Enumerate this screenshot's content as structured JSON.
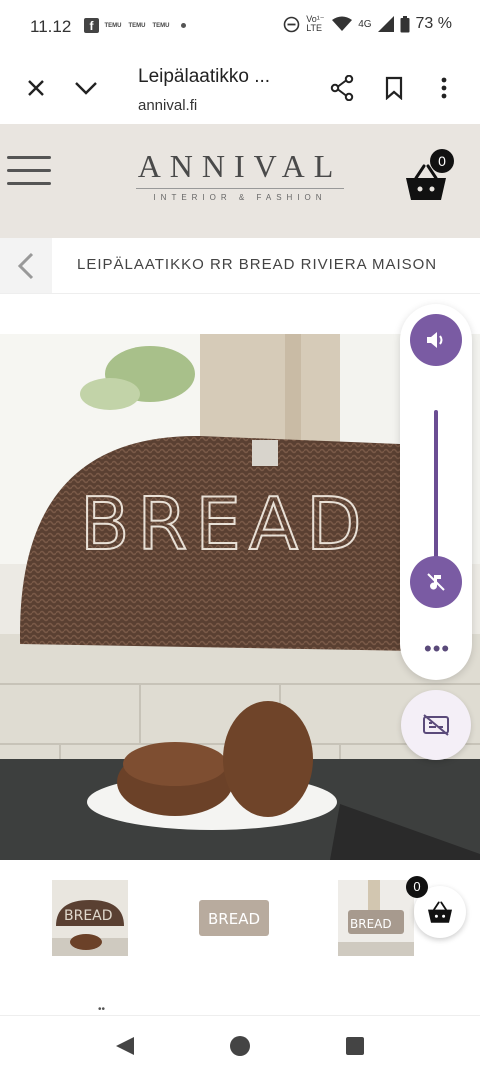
{
  "status": {
    "time": "11.12",
    "temu_labels": [
      "TEMU",
      "TEMU",
      "TEMU"
    ],
    "net": "Vo¹⁻ LTE",
    "signal": "4G",
    "battery": "73 %"
  },
  "browser": {
    "title": "Leipälaatikko ...",
    "url": "annival.fi"
  },
  "site": {
    "logo": "ANNIVAL",
    "tagline": "INTERIOR & FASHION",
    "cart_count": "0"
  },
  "breadcrumb": {
    "text": "LEIPÄLAATIKKO RR BREAD RIVIERA MAISON"
  },
  "product": {
    "image_text": "BREAD"
  },
  "thumbs": [
    {
      "text": "BREAD"
    },
    {
      "text": "BREAD"
    },
    {
      "text": "BREAD"
    }
  ],
  "floating_cart": {
    "count": "0"
  },
  "colors": {
    "header_bg": "#e9e5e0",
    "volume_accent": "#7a5ba3"
  }
}
